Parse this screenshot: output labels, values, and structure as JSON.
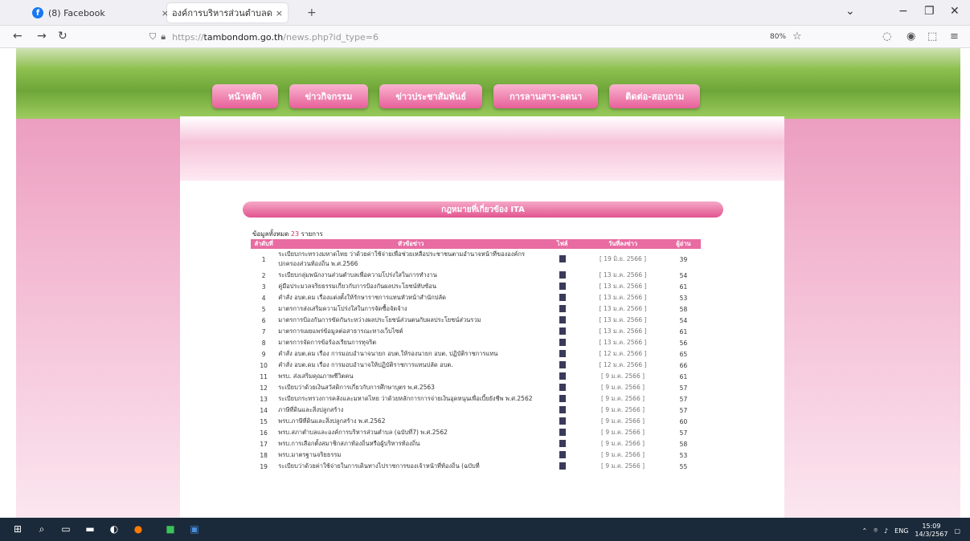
{
  "tabs": [
    {
      "title": "(8) Facebook",
      "close": "×"
    },
    {
      "title": "องค์การบริหารส่วนตำบลดม อำเภอสั...",
      "close": "×"
    }
  ],
  "new_tab": "+",
  "url": {
    "prefix": "https://",
    "domain": "tambondom.go.th",
    "path": "/news.php?id_type=6"
  },
  "zoom": "80%",
  "menu": [
    "หน้าหลัก",
    "ข่าวกิจกรรม",
    "ข่าวประชาสัมพันธ์",
    "การลานสาร-ลดนา",
    "ติดต่อ-สอบถาม"
  ],
  "section_title": "กฎหมายที่เกี่ยวข้อง ITA",
  "summary": {
    "label": "ข้อมูลทั้งหมด",
    "count": "23",
    "unit": "รายการ"
  },
  "table": {
    "headers": [
      "ลำดับที่",
      "หัวข้อข่าว",
      "ไฟล์",
      "วันที่ลงข่าว",
      "ผู้อ่าน"
    ],
    "rows": [
      {
        "no": "1",
        "title": "ระเบียบกระทรวงมหาดไทย ว่าด้วยค่าใช้จ่ายเพื่อช่วยเหลือประชาชนตามอำนาจหน้าที่ขององค์กรปกครองส่วนท้องถิ่น พ.ศ.2566",
        "date": "[ 19 มิ.ย. 2566 ]",
        "views": "39"
      },
      {
        "no": "2",
        "title": "ระเบียบกลุ่มพนักงานส่วนตำบลเพื่อความโปร่งใสในการทำงาน",
        "date": "[ 13 ม.ค. 2566 ]",
        "views": "54"
      },
      {
        "no": "3",
        "title": "คู่มือประมวลจริยธรรมเกี่ยวกับการป้องกันผลประโยชน์ทับซ้อน",
        "date": "[ 13 ม.ค. 2566 ]",
        "views": "61"
      },
      {
        "no": "4",
        "title": "คำสั่ง อบต.ดม เรื่องแต่งตั้งให้รักษาราชการแทนหัวหน้าสำนักปลัด",
        "date": "[ 13 ม.ค. 2566 ]",
        "views": "53"
      },
      {
        "no": "5",
        "title": "มาตรการส่งเสริมความโปร่งใสในการจัดซื้อจัดจ้าง",
        "date": "[ 13 ม.ค. 2566 ]",
        "views": "58"
      },
      {
        "no": "6",
        "title": "มาตรการป้องกันการขัดกันระหว่างผลประโยชน์ส่วนตนกับผลประโยชน์ส่วนรวม",
        "date": "[ 13 ม.ค. 2566 ]",
        "views": "54"
      },
      {
        "no": "7",
        "title": "มาตรการเผยแพร่ข้อมูลต่อสาธารณะทางเว็บไซต์",
        "date": "[ 13 ม.ค. 2566 ]",
        "views": "61"
      },
      {
        "no": "8",
        "title": "มาตรการจัดการข้อร้องเรียนการทุจริต",
        "date": "[ 13 ม.ค. 2566 ]",
        "views": "56"
      },
      {
        "no": "9",
        "title": "คำสั่ง อบต.ดม เรื่อง การมอบอำนาจนายก อบต.ให้รองนายก อบต. ปฏิบัติราชการแทน",
        "date": "[ 12 ม.ค. 2566 ]",
        "views": "65"
      },
      {
        "no": "10",
        "title": "คำสั่ง อบต.ดม เรื่อง การมอบอำนาจให้ปฏิบัติราชการแทนปลัด อบต.",
        "date": "[ 12 ม.ค. 2566 ]",
        "views": "66"
      },
      {
        "no": "11",
        "title": "พรบ. ส่งเสริมคุณภาพชีวิตคน",
        "date": "[ 9 ม.ค. 2566 ]",
        "views": "61"
      },
      {
        "no": "12",
        "title": "ระเบียบว่าด้วยเงินสวัสดิการเกี่ยวกับการศึกษาบุตร พ.ศ.2563",
        "date": "[ 9 ม.ค. 2566 ]",
        "views": "57"
      },
      {
        "no": "13",
        "title": "ระเบียบกระทรวงการคลังและมหาดไทย ว่าด้วยหลักการการจ่ายเงินอุดหนุนเพื่อเบี้ยยังชีพ พ.ศ.2562",
        "date": "[ 9 ม.ค. 2566 ]",
        "views": "57"
      },
      {
        "no": "14",
        "title": "ภาษีที่ดินและสิ่งปลูกสร้าง",
        "date": "[ 9 ม.ค. 2566 ]",
        "views": "57"
      },
      {
        "no": "15",
        "title": "พรบ.ภาษีที่ดินและสิ่งปลูกสร้าง พ.ศ.2562",
        "date": "[ 9 ม.ค. 2566 ]",
        "views": "60"
      },
      {
        "no": "16",
        "title": "พรบ.สภาตำบลและองค์การบริหารส่วนตำบล (ฉบับที่7) พ.ศ.2562",
        "date": "[ 9 ม.ค. 2566 ]",
        "views": "57"
      },
      {
        "no": "17",
        "title": "พรบ.การเลือกตั้งสมาชิกสภาท้องถิ่นหรือผู้บริหารท้องถิ่น",
        "date": "[ 9 ม.ค. 2566 ]",
        "views": "58"
      },
      {
        "no": "18",
        "title": "พรบ.มาตรฐานจริยธรรม",
        "date": "[ 9 ม.ค. 2566 ]",
        "views": "53"
      },
      {
        "no": "19",
        "title": "ระเบียบว่าด้วยค่าใช้จ่ายในการเดินทางไปราชการของเจ้าหน้าที่ท้องถิ่น (ฉบับที่",
        "date": "[ 9 ม.ค. 2566 ]",
        "views": "55"
      }
    ]
  },
  "taskbar": {
    "lang": "ENG",
    "time": "15:09",
    "date": "14/3/2567"
  },
  "colors": {
    "pink": "#e86ba2",
    "accent": "#d2236b"
  }
}
